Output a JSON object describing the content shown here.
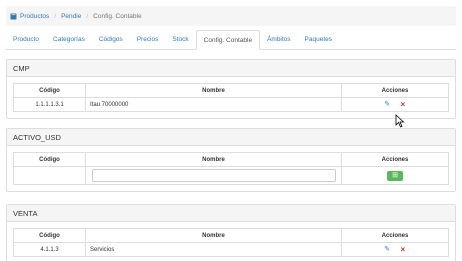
{
  "breadcrumb": {
    "icon": "book-icon",
    "items": [
      "Productos",
      "Pendie",
      "Config. Contable"
    ],
    "separator": "/"
  },
  "tabs": [
    {
      "label": "Producto",
      "active": false
    },
    {
      "label": "Categorías",
      "active": false
    },
    {
      "label": "Códigos",
      "active": false
    },
    {
      "label": "Precios",
      "active": false
    },
    {
      "label": "Stock",
      "active": false
    },
    {
      "label": "Config. Contable",
      "active": true
    },
    {
      "label": "Ámbitos",
      "active": false
    },
    {
      "label": "Paquetes",
      "active": false
    }
  ],
  "columns": {
    "code": "Código",
    "name": "Nombre",
    "actions": "Acciones"
  },
  "panels": [
    {
      "title": "CMP",
      "rows": [
        {
          "code": "1.1.1.1.3.1",
          "name": "Itau 70000000"
        }
      ]
    },
    {
      "title": "ACTIVO_USD",
      "input_value": "",
      "add_icon": "plus-square-icon"
    },
    {
      "title": "VENTA",
      "rows": [
        {
          "code": "4.1.1.3",
          "name": "Servicios"
        }
      ]
    }
  ],
  "colors": {
    "link": "#337ab7",
    "add_button": "#5cb85c",
    "delete": "#c9302c",
    "panel_header": "#f5f5f5"
  }
}
